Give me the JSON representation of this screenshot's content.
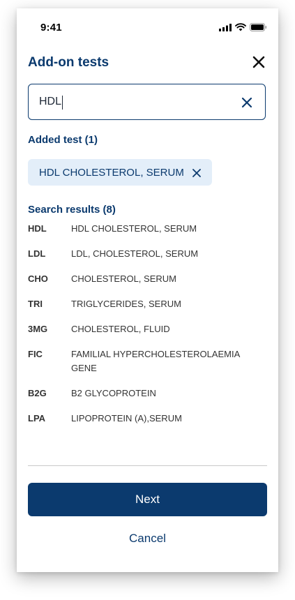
{
  "status_bar": {
    "time": "9:41"
  },
  "header": {
    "title": "Add-on tests",
    "close_icon": "close-icon"
  },
  "search": {
    "value": "HDL",
    "clear_icon": "clear-icon"
  },
  "added": {
    "title": "Added test (1)",
    "chips": [
      {
        "label": "HDL CHOLESTEROL, SERUM"
      }
    ]
  },
  "results": {
    "title": "Search results (8)",
    "items": [
      {
        "code": "HDL",
        "name": "HDL CHOLESTEROL, SERUM"
      },
      {
        "code": "LDL",
        "name": "LDL, CHOLESTEROL, SERUM"
      },
      {
        "code": "CHO",
        "name": "CHOLESTEROL, SERUM"
      },
      {
        "code": "TRI",
        "name": "TRIGLYCERIDES, SERUM"
      },
      {
        "code": "3MG",
        "name": "CHOLESTEROL, FLUID"
      },
      {
        "code": "FIC",
        "name": "FAMILIAL HYPERCHOLESTEROLAEMIA GENE"
      },
      {
        "code": "B2G",
        "name": "B2 GLYCOPROTEIN"
      },
      {
        "code": "LPA",
        "name": "LIPOPROTEIN (A),SERUM"
      }
    ]
  },
  "actions": {
    "next_label": "Next",
    "cancel_label": "Cancel"
  },
  "colors": {
    "primary": "#0b3a6e",
    "chip_bg": "#e3eef9"
  }
}
